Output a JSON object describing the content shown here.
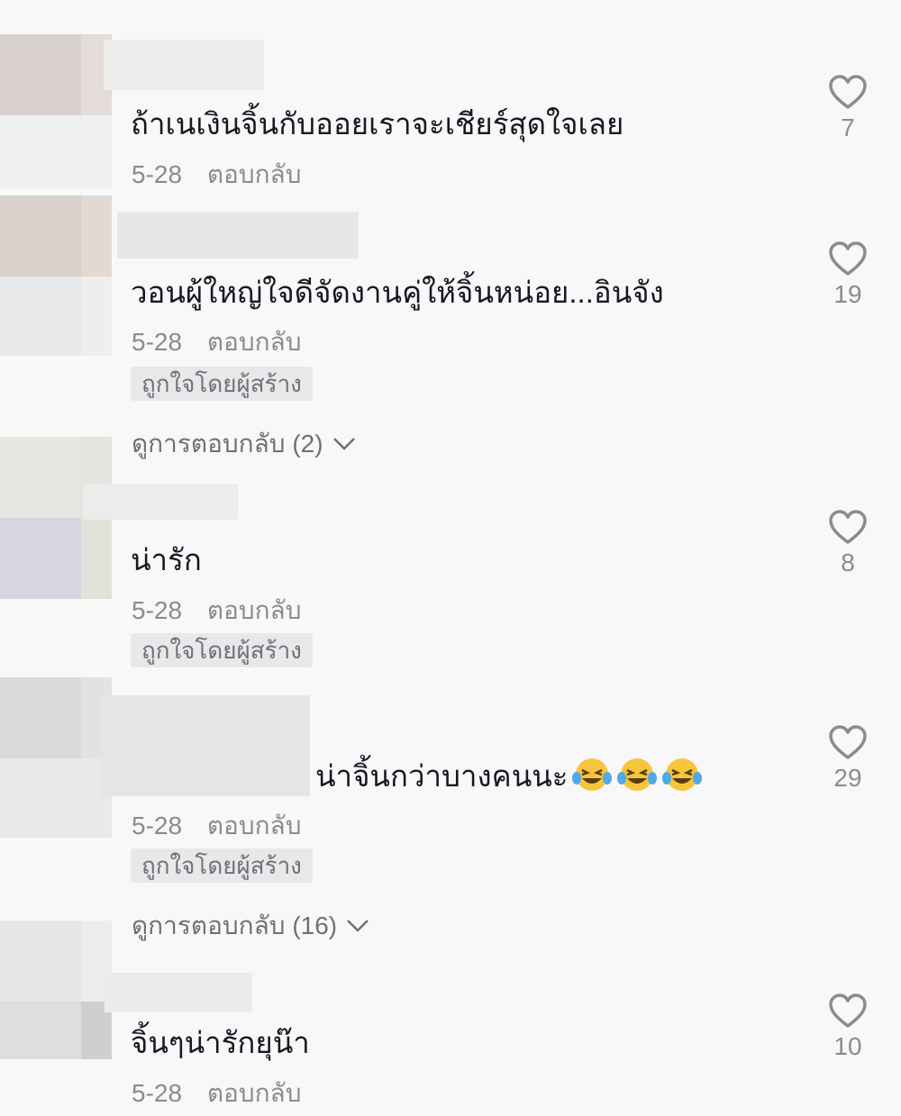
{
  "comments": [
    {
      "text": "ถ้าเนเงินจิ้นกับออยเราจะเชียร์สุดใจเลย",
      "date": "5-28",
      "reply_label": "ตอบกลับ",
      "likes": "7"
    },
    {
      "text": "วอนผู้ใหญ่ใจดีจัดงานคู่ให้จิ้นหน่อย...อินจัง",
      "date": "5-28",
      "reply_label": "ตอบกลับ",
      "creator_badge": "ถูกใจโดยผู้สร้าง",
      "view_replies": "ดูการตอบกลับ (2)",
      "likes": "19"
    },
    {
      "text": "น่ารัก",
      "date": "5-28",
      "reply_label": "ตอบกลับ",
      "creator_badge": "ถูกใจโดยผู้สร้าง",
      "likes": "8"
    },
    {
      "text": "น่าจิ้นกว่าบางคนนะ",
      "emojis": [
        "face-with-tears-of-joy",
        "face-with-tears-of-joy",
        "face-with-tears-of-joy"
      ],
      "date": "5-28",
      "reply_label": "ตอบกลับ",
      "creator_badge": "ถูกใจโดยผู้สร้าง",
      "view_replies": "ดูการตอบกลับ (16)",
      "likes": "29"
    },
    {
      "text": "จิ้นๆน่ารักยุน๊า",
      "date": "5-28",
      "reply_label": "ตอบกลับ",
      "likes": "10"
    }
  ],
  "icons": {
    "like": "heart-outline-icon",
    "expand": "chevron-down-icon"
  },
  "colors": {
    "background": "#f8f8f8",
    "text": "#161823",
    "secondary_text": "#8a8b91",
    "badge_bg": "#e8e8ea"
  }
}
